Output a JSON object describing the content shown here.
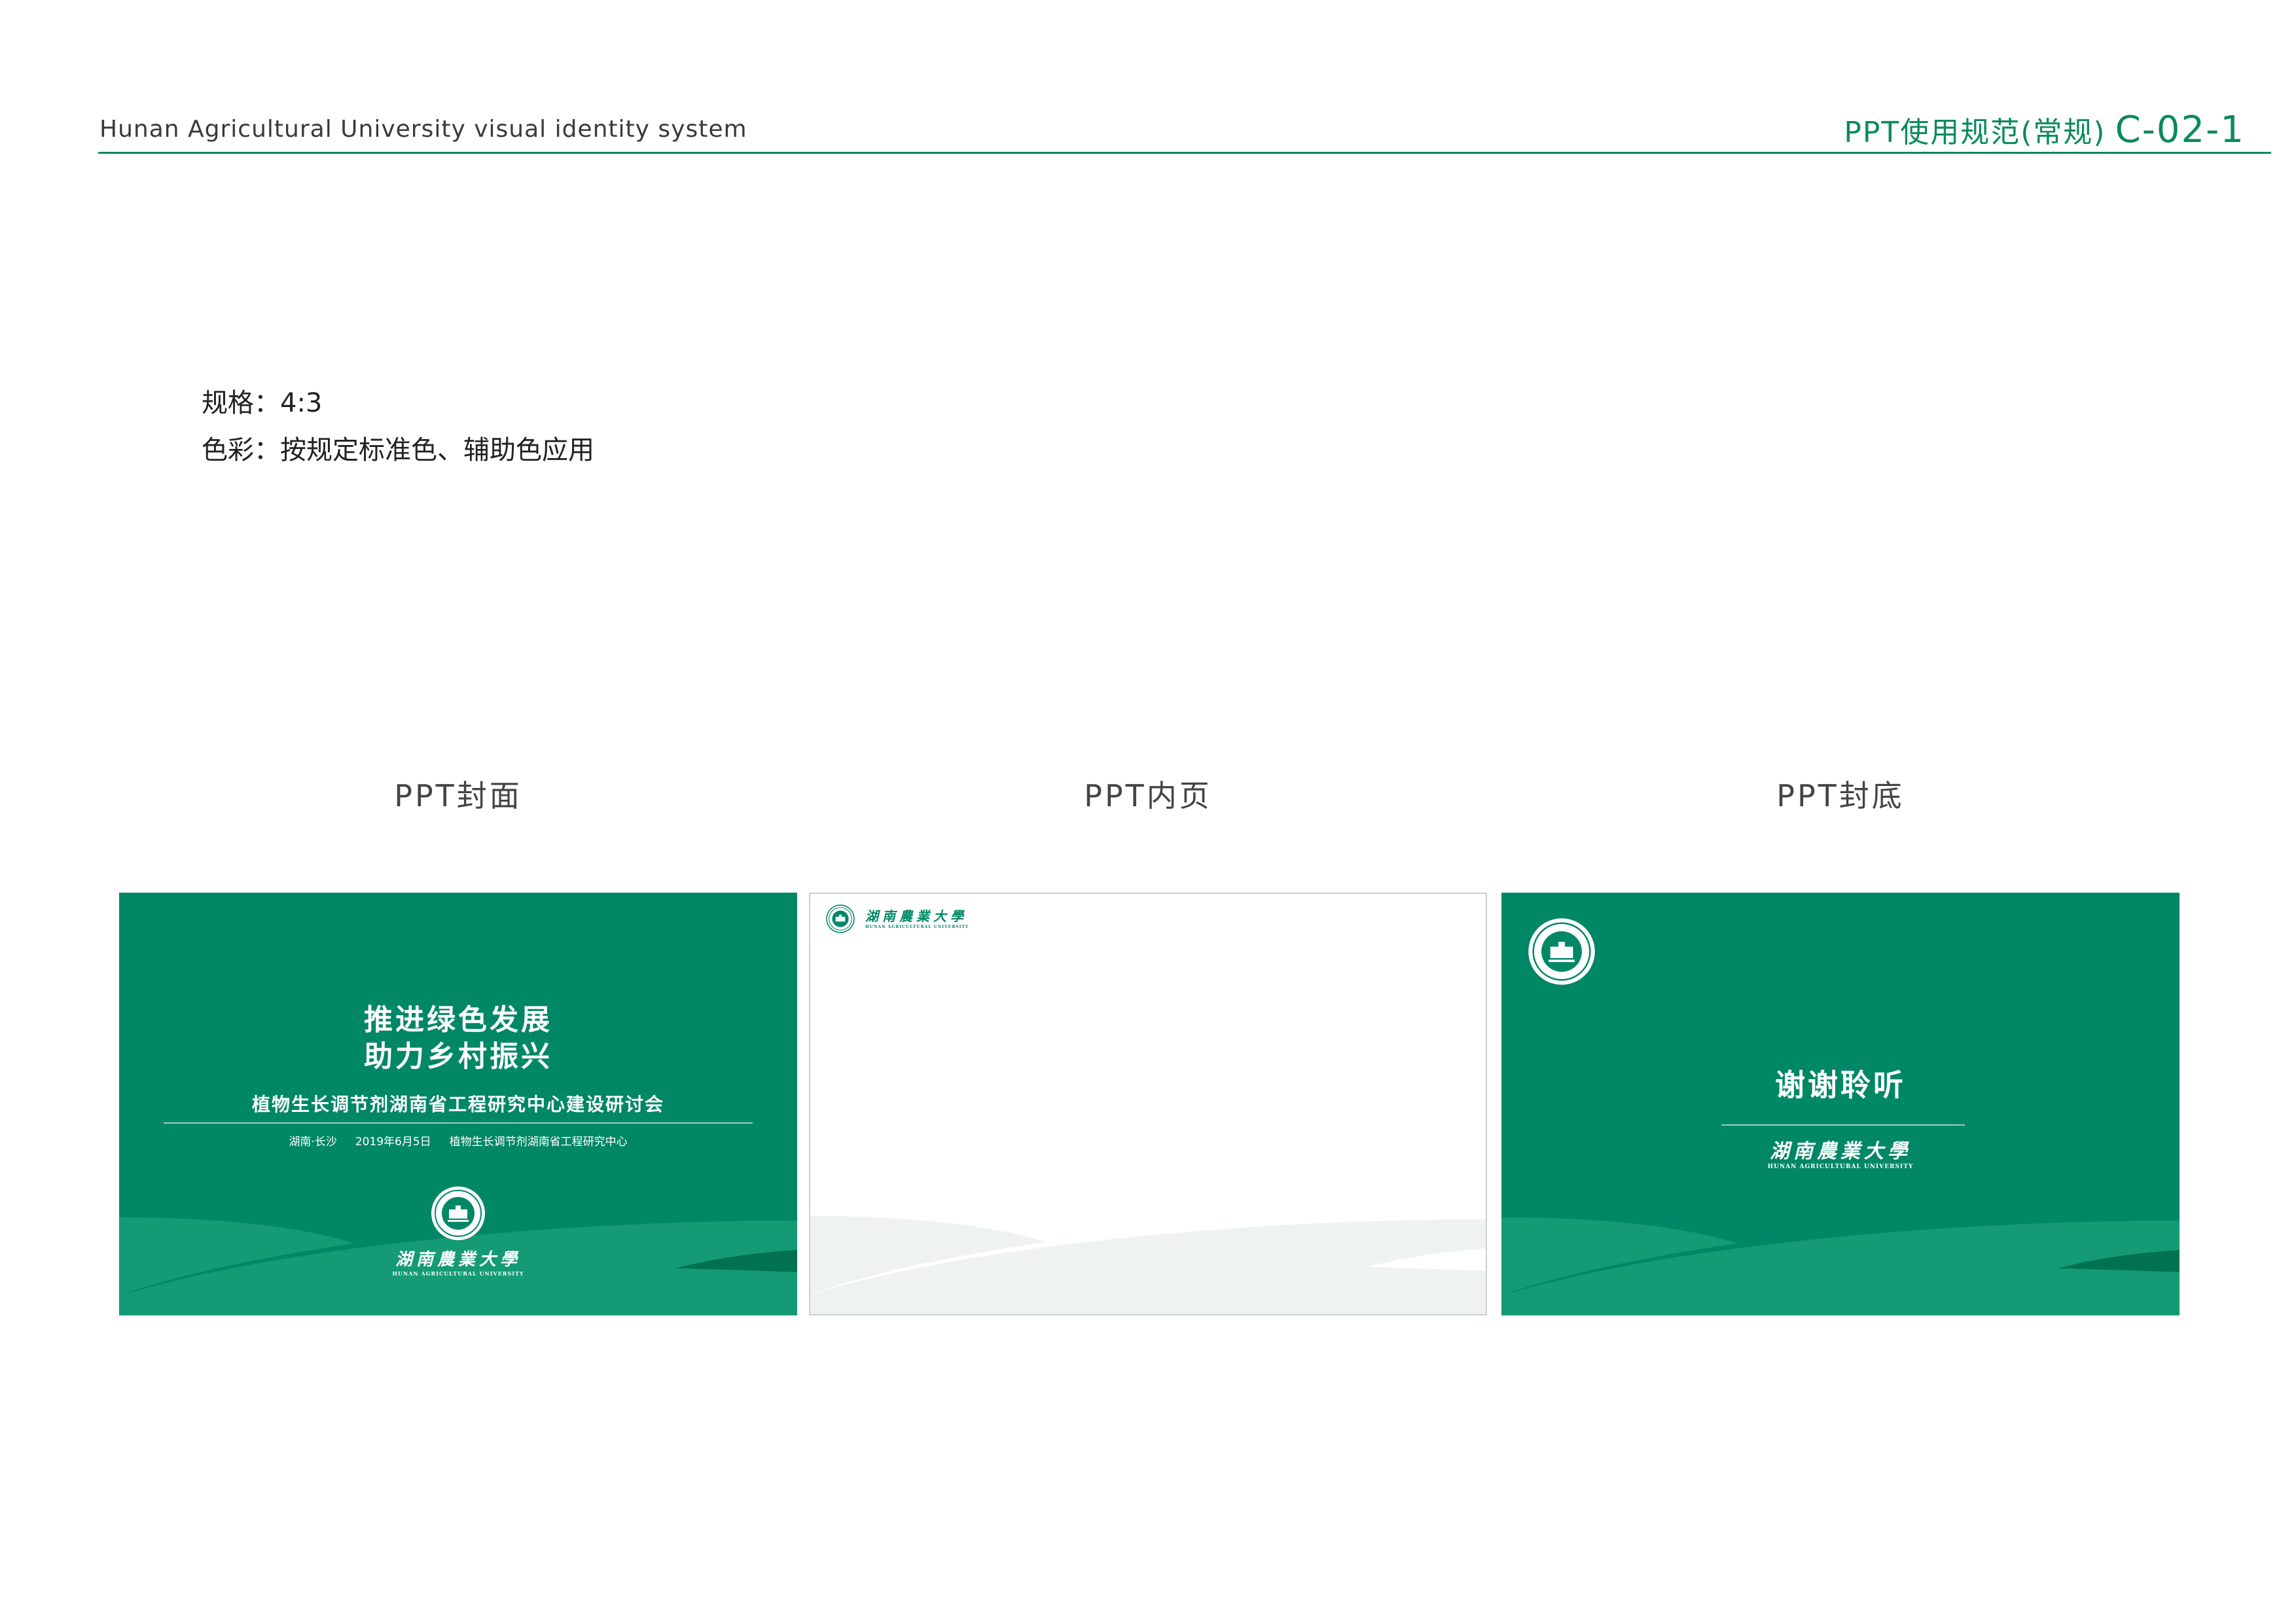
{
  "header": {
    "title": "Hunan Agricultural University visual identity system",
    "section": "PPT使用规范(常规)",
    "code": "C-02-1"
  },
  "specs": {
    "format": "规格：4:3",
    "color": "色彩：按规定标准色、辅助色应用"
  },
  "colors": {
    "brand_green": "#008766",
    "wave_green": "#149a74",
    "dark_green": "#00724f",
    "header_green": "#0b8a5e"
  },
  "panels": [
    {
      "label": "PPT封面",
      "title_line1": "推进绿色发展",
      "title_line2": "助力乡村振兴",
      "subtitle": "植物生长调节剂湖南省工程研究中心建设研讨会",
      "meta_place": "湖南·长沙",
      "meta_date": "2019年6月5日",
      "meta_org": "植物生长调节剂湖南省工程研究中心",
      "wordmark_cn": "湖南農業大學",
      "wordmark_en": "HUNAN AGRICULTURAL UNIVERSITY"
    },
    {
      "label": "PPT内页",
      "wordmark_cn": "湖南農業大學",
      "wordmark_en": "HUNAN AGRICULTURAL UNIVERSITY"
    },
    {
      "label": "PPT封底",
      "thanks": "谢谢聆听",
      "wordmark_cn": "湖南農業大學",
      "wordmark_en": "HUNAN AGRICULTURAL UNIVERSITY"
    }
  ]
}
